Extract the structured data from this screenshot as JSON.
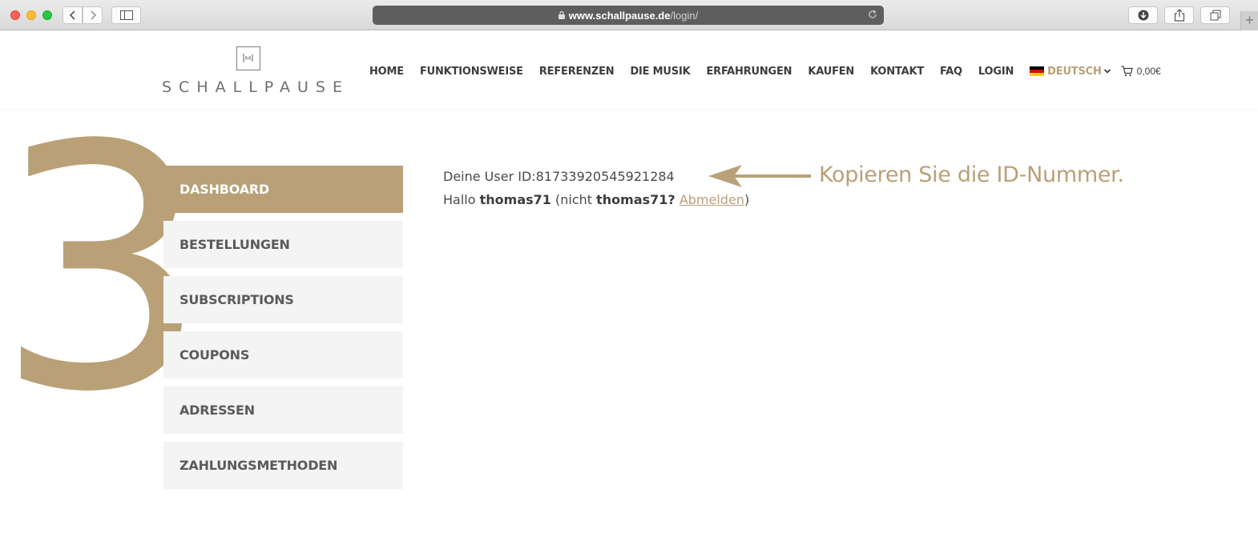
{
  "browser": {
    "url_host": "www.schallpause.de",
    "url_path": "/login/",
    "new_tab": "+"
  },
  "header": {
    "logo_text": "SCHALLPAUSE",
    "nav": [
      "HOME",
      "FUNKTIONSWEISE",
      "REFERENZEN",
      "DIE MUSIK",
      "ERFAHRUNGEN",
      "KAUFEN",
      "KONTAKT",
      "FAQ",
      "LOGIN"
    ],
    "language": "DEUTSCH",
    "cart_total": "0,00€"
  },
  "step_number": "3",
  "menu": {
    "items": [
      "DASHBOARD",
      "BESTELLUNGEN",
      "SUBSCRIPTIONS",
      "COUPONS",
      "ADRESSEN",
      "ZAHLUNGSMETHODEN"
    ],
    "active": "DASHBOARD"
  },
  "content": {
    "user_id_label": "Deine User ID:",
    "user_id": "81733920545921284",
    "hello": "Hallo",
    "username": "thomas71",
    "not_prefix": "(nicht",
    "username_q": "thomas71?",
    "logout": "Abmelden",
    "close_paren": ")"
  },
  "annotation": {
    "text": "Kopieren Sie die ID-Nummer."
  },
  "colors": {
    "accent": "#b9a077",
    "menu_bg": "#f4f4f4",
    "text": "#4a4a4a"
  }
}
